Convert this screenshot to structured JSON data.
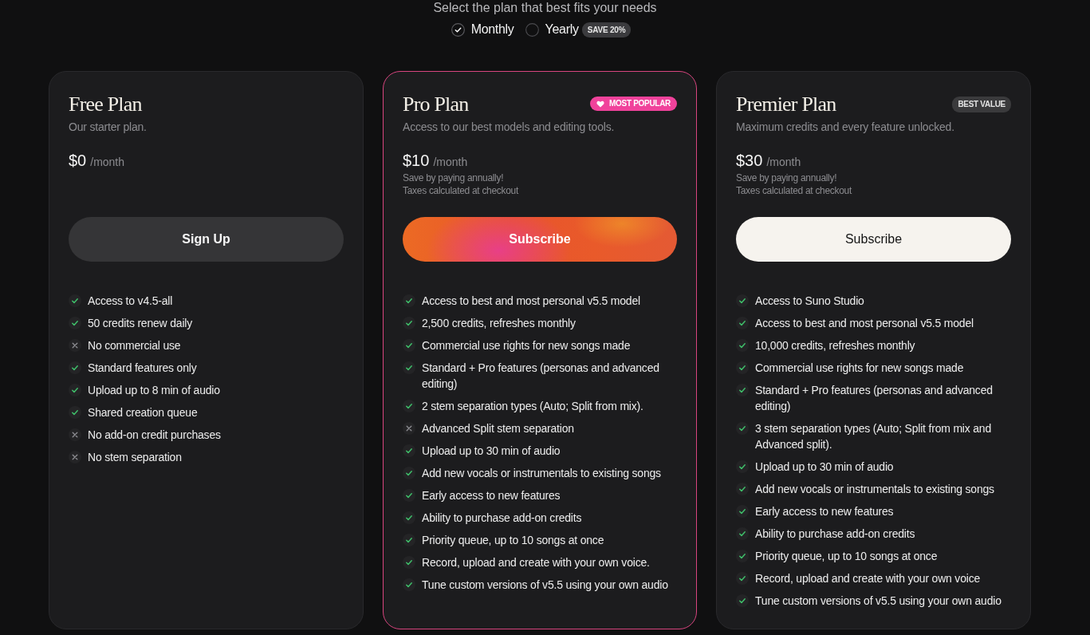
{
  "header": {
    "subtitle": "Select the plan that best fits your needs"
  },
  "billing_options": [
    {
      "label": "Monthly",
      "selected": true
    },
    {
      "label": "Yearly",
      "selected": false,
      "badge": "SAVE 20%"
    }
  ],
  "plans": [
    {
      "name": "Free Plan",
      "highlighted": false,
      "description": "Our starter plan.",
      "price": "$0",
      "period": "/month",
      "button": {
        "label": "Sign Up",
        "kind": "secondary"
      },
      "features": [
        {
          "text": "Access to v4.5-all",
          "included": true
        },
        {
          "text": "50 credits renew daily",
          "included": true
        },
        {
          "text": "No commercial use",
          "included": false
        },
        {
          "text": "Standard features only",
          "included": true
        },
        {
          "text": "Upload up to 8 min of audio",
          "included": true
        },
        {
          "text": "Shared creation queue",
          "included": true
        },
        {
          "text": "No add-on credit purchases",
          "included": false
        },
        {
          "text": "No stem separation",
          "included": false
        }
      ]
    },
    {
      "name": "Pro Plan",
      "highlighted": true,
      "badge": {
        "label": "MOST POPULAR",
        "kind": "popular"
      },
      "description": "Access to our best models and editing tools.",
      "price": "$10",
      "period": "/month",
      "notes": [
        "Save by paying annually!",
        "Taxes calculated at checkout"
      ],
      "button": {
        "label": "Subscribe",
        "kind": "gradient"
      },
      "features": [
        {
          "text": "Access to best and most personal v5.5 model",
          "included": true
        },
        {
          "text": "2,500 credits, refreshes monthly",
          "included": true
        },
        {
          "text": "Commercial use rights for new songs made",
          "included": true
        },
        {
          "text": "Standard + Pro features (personas and advanced editing)",
          "included": true
        },
        {
          "text": "2 stem separation types (Auto; Split from mix).",
          "included": true
        },
        {
          "text": "Advanced Split stem separation",
          "included": false
        },
        {
          "text": "Upload up to 30 min of audio",
          "included": true
        },
        {
          "text": "Add new vocals or instrumentals to existing songs",
          "included": true
        },
        {
          "text": "Early access to new features",
          "included": true
        },
        {
          "text": "Ability to purchase add-on credits",
          "included": true
        },
        {
          "text": "Priority queue, up to 10 songs at once",
          "included": true
        },
        {
          "text": "Record, upload and create with your own voice.",
          "included": true
        },
        {
          "text": "Tune custom versions of v5.5 using your own audio",
          "included": true
        }
      ]
    },
    {
      "name": "Premier Plan",
      "highlighted": false,
      "badge": {
        "label": "BEST VALUE",
        "kind": "value"
      },
      "description": "Maximum credits and every feature unlocked.",
      "price": "$30",
      "period": "/month",
      "notes": [
        "Save by paying annually!",
        "Taxes calculated at checkout"
      ],
      "button": {
        "label": "Subscribe",
        "kind": "light"
      },
      "features": [
        {
          "text": "Access to Suno Studio",
          "included": true
        },
        {
          "text": "Access to best and most personal v5.5 model",
          "included": true
        },
        {
          "text": "10,000 credits, refreshes monthly",
          "included": true
        },
        {
          "text": "Commercial use rights for new songs made",
          "included": true
        },
        {
          "text": "Standard + Pro features (personas and advanced editing)",
          "included": true
        },
        {
          "text": "3 stem separation types (Auto; Split from mix and Advanced split).",
          "included": true
        },
        {
          "text": "Upload up to 30 min of audio",
          "included": true
        },
        {
          "text": "Add new vocals or instrumentals to existing songs",
          "included": true
        },
        {
          "text": "Early access to new features",
          "included": true
        },
        {
          "text": "Ability to purchase add-on credits",
          "included": true
        },
        {
          "text": "Priority queue, up to 10 songs at once",
          "included": true
        },
        {
          "text": "Record, upload and create with your own voice",
          "included": true
        },
        {
          "text": "Tune custom versions of v5.5 using your own audio",
          "included": true
        }
      ]
    }
  ]
}
